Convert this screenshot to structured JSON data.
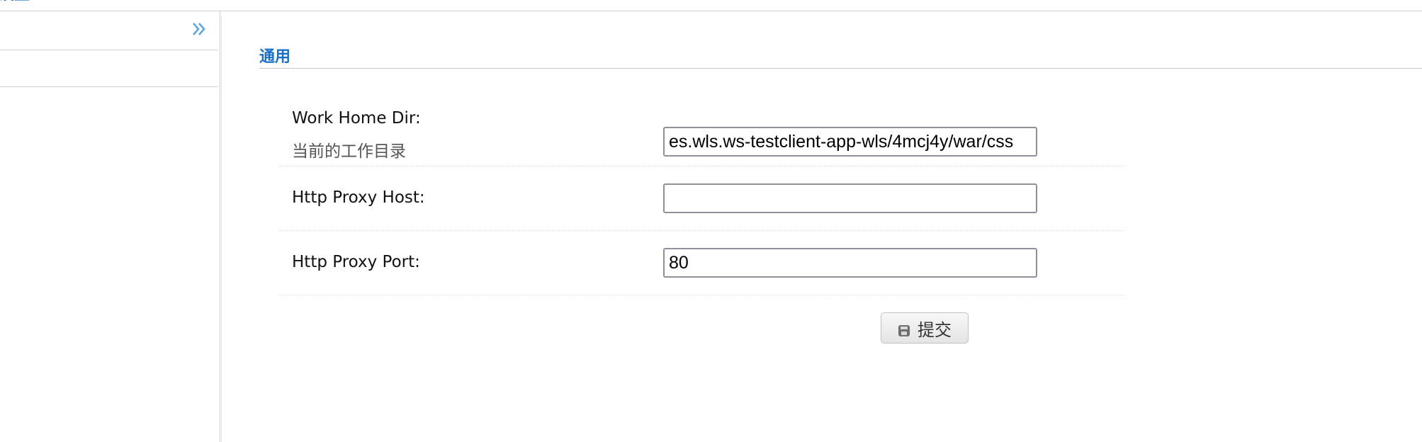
{
  "header": {
    "title": "设置"
  },
  "sidebar": {
    "collapse_icon": "double-chevron-right-icon"
  },
  "section": {
    "title": "通用"
  },
  "form": {
    "fields": [
      {
        "label": "Work Home Dir:",
        "sublabel": "当前的工作目录",
        "value": "es.wls.ws-testclient-app-wls/4mcj4y/war/css"
      },
      {
        "label": "Http Proxy Host:",
        "value": ""
      },
      {
        "label": "Http Proxy Port:",
        "value": "80"
      }
    ],
    "submit_label": "提交",
    "submit_icon": "save-icon"
  },
  "colors": {
    "accent": "#1a6fc7",
    "chevron": "#5aa7e0"
  }
}
